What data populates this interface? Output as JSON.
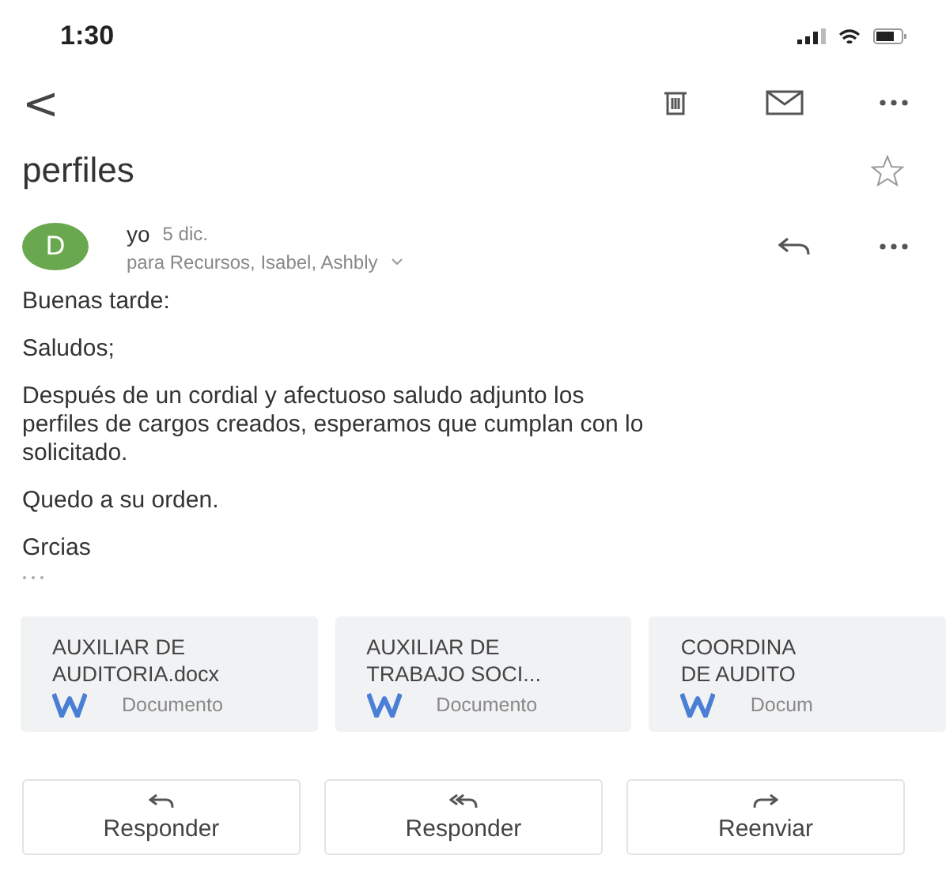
{
  "status_bar": {
    "time": "1:30"
  },
  "toolbar": {
    "back": "<"
  },
  "subject": {
    "title": "perfiles",
    "starred": false
  },
  "message": {
    "avatar": "D",
    "sender": "yo",
    "date": "5 dic.",
    "recipients": "para Recursos, Isabel, Ashbly"
  },
  "body": [
    "Buenas tarde:",
    "Saludos;",
    "Después de un cordial y afectuoso saludo adjunto los perfiles de cargos creados, esperamos que cumplan con lo solicitado.",
    "Quedo a su orden.",
    "Grcias"
  ],
  "attachments": [
    {
      "name": [
        "AUXILIAR DE",
        "AUDITORIA.docx"
      ],
      "type": "Documento"
    },
    {
      "name": [
        "AUXILIAR DE",
        "TRABAJO SOCI..."
      ],
      "type": "Documento"
    },
    {
      "name": [
        "COORDINA",
        "DE AUDITO"
      ],
      "type": "Docum"
    }
  ],
  "actions": [
    {
      "kind": "reply",
      "label": "Responder"
    },
    {
      "kind": "reply_all",
      "label": "Responder"
    },
    {
      "kind": "forward",
      "label": "Reenviar"
    }
  ]
}
